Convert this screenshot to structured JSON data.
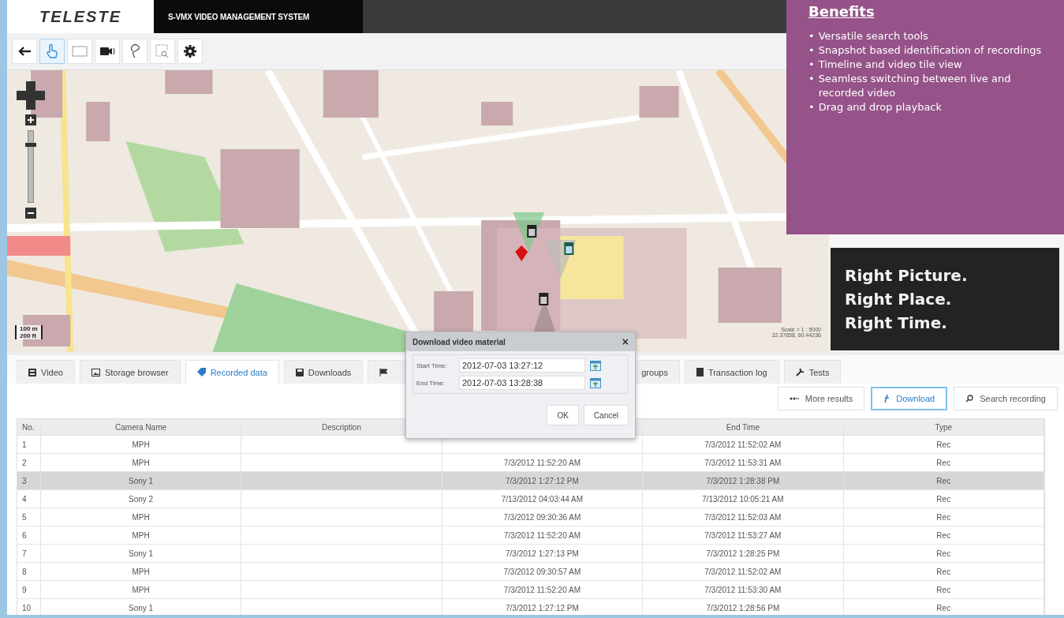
{
  "header": {
    "logo": "TELESTE",
    "title": "S-VMX VIDEO MANAGEMENT SYSTEM"
  },
  "toolbar": [
    {
      "kind": "back",
      "selected": false
    },
    {
      "kind": "hand",
      "selected": true
    },
    {
      "kind": "rectangle",
      "selected": false
    },
    {
      "kind": "camera",
      "selected": false
    },
    {
      "kind": "lasso",
      "selected": false
    },
    {
      "kind": "zoom-area",
      "selected": false
    },
    {
      "kind": "settings",
      "selected": false
    }
  ],
  "map": {
    "zoom": {
      "level": 0.8
    },
    "scale_metric": "100 m",
    "scale_imperial": "200 ft",
    "scale": "Scale = 1 : 5000",
    "coordinates": "22.37658, 60.44236"
  },
  "banner": {
    "lines": [
      "Right Picture.",
      "Right Place.",
      "Right Time."
    ]
  },
  "benefits": {
    "title": "Benefits",
    "items": [
      {
        "bullet": "•",
        "text": "Versatile search tools"
      },
      {
        "bullet": "•",
        "text": "Snapshot based identification of recordings"
      },
      {
        "bullet": "•",
        "text": "Timeline and video tile view"
      },
      {
        "bullet": "•",
        "text": "Seamless switching between live and recorded video"
      },
      {
        "bullet": "•",
        "text": "Drag and drop playback"
      }
    ]
  },
  "tabs": [
    {
      "label": "Video",
      "kind": "film",
      "selected": false
    },
    {
      "label": "Storage browser",
      "kind": "image",
      "selected": false
    },
    {
      "label": "Recorded data",
      "kind": "tag",
      "selected": true
    },
    {
      "label": "Downloads",
      "kind": "disk",
      "selected": false
    },
    {
      "kind": "flag",
      "selected": false
    },
    {
      "label": "groups",
      "kind": "plain",
      "selected": false
    },
    {
      "label": "Transaction log",
      "kind": "book",
      "selected": false
    },
    {
      "label": "Tests",
      "kind": "wrench",
      "selected": false
    }
  ],
  "actions": [
    {
      "label": "More results",
      "kind": "dots",
      "focused": false
    },
    {
      "label": "Download",
      "kind": "download",
      "focused": true
    },
    {
      "label": "Search recording",
      "kind": "search",
      "focused": false
    }
  ],
  "table": {
    "columns": [
      {
        "label": "No."
      },
      {
        "label": "Camera Name"
      },
      {
        "label": "Description"
      },
      {},
      {
        "label": "End Time"
      },
      {
        "label": "Type"
      }
    ],
    "rows": [
      {
        "no": "1",
        "camera": "MPH",
        "end": "7/3/2012 11:52:02 AM",
        "type": "Rec",
        "selected": false
      },
      {
        "no": "2",
        "camera": "MPH",
        "start": "7/3/2012 11:52:20 AM",
        "end": "7/3/2012 11:53:31 AM",
        "type": "Rec",
        "selected": false
      },
      {
        "no": "3",
        "camera": "Sony 1",
        "start": "7/3/2012 1:27:12 PM",
        "end": "7/3/2012 1:28:38 PM",
        "type": "Rec",
        "selected": true
      },
      {
        "no": "4",
        "camera": "Sony 2",
        "start": "7/13/2012 04:03:44 AM",
        "end": "7/13/2012 10:05:21 AM",
        "type": "Rec",
        "selected": false
      },
      {
        "no": "5",
        "camera": "MPH",
        "start": "7/3/2012 09:30:36 AM",
        "end": "7/3/2012 11:52:03 AM",
        "type": "Rec",
        "selected": false
      },
      {
        "no": "6",
        "camera": "MPH",
        "start": "7/3/2012 11:52:20 AM",
        "end": "7/3/2012 11:53:27 AM",
        "type": "Rec",
        "selected": false
      },
      {
        "no": "7",
        "camera": "Sony 1",
        "start": "7/3/2012 1:27:13 PM",
        "end": "7/3/2012 1:28:25 PM",
        "type": "Rec",
        "selected": false
      },
      {
        "no": "8",
        "camera": "MPH",
        "start": "7/3/2012 09:30:57 AM",
        "end": "7/3/2012 11:52:02 AM",
        "type": "Rec",
        "selected": false
      },
      {
        "no": "9",
        "camera": "MPH",
        "start": "7/3/2012 11:52:20 AM",
        "end": "7/3/2012 11:53:30 AM",
        "type": "Rec",
        "selected": false
      },
      {
        "no": "10",
        "camera": "Sony 1",
        "start": "7/3/2012 1:27:12 PM",
        "end": "7/3/2012 1:28:56 PM",
        "type": "Rec",
        "selected": false
      }
    ]
  },
  "dialog": {
    "title": "Download video material",
    "close": "×",
    "fields": [
      {
        "label": "Start Time:",
        "value": "2012-07-03 13:27:12"
      },
      {
        "label": "End Time:",
        "value": "2012-07-03 13:28:38"
      }
    ],
    "buttons": [
      "OK",
      "Cancel"
    ]
  }
}
